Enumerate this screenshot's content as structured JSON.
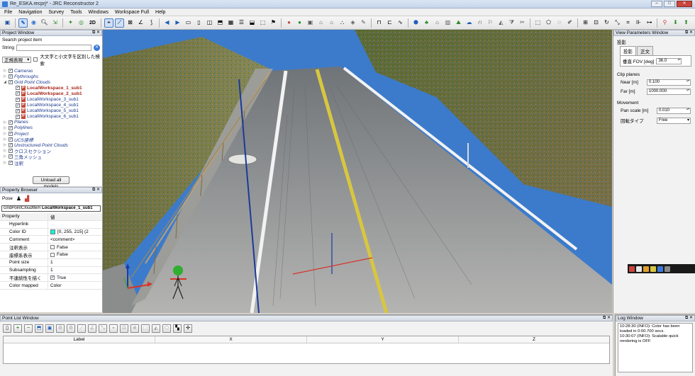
{
  "window": {
    "title": "Re_ESKA.recprj* - JRC Reconstructor 2"
  },
  "menu": [
    "File",
    "Navigation",
    "Survey",
    "Tools",
    "Windows",
    "Workspace Full",
    "Help"
  ],
  "toolbar": {
    "mode_2d_label": "2D"
  },
  "project_window": {
    "title": "Project Window",
    "search_label": "Search project item",
    "string_label": "String",
    "regex_select": "正規表現",
    "case_option_label": "大文字と小文字を区別した検索",
    "tree": [
      {
        "label": "Cameras",
        "style": "italic blue",
        "checked": true,
        "level": 0
      },
      {
        "label": "Flythroughs",
        "style": "italic blue",
        "checked": true,
        "level": 0
      },
      {
        "label": "Grid Point Clouds",
        "style": "italic blue",
        "checked": true,
        "level": 0
      },
      {
        "label": "LocalWorkspace_1_sub1",
        "style": "red",
        "checked": true,
        "level": 1
      },
      {
        "label": "LocalWorkspace_2_sub1",
        "style": "red",
        "checked": true,
        "level": 1
      },
      {
        "label": "LocalWorkspace_3_sub1",
        "style": "blue",
        "checked": true,
        "level": 1
      },
      {
        "label": "LocalWorkspace_4_sub1",
        "style": "blue",
        "checked": true,
        "level": 1
      },
      {
        "label": "LocalWorkspace_5_sub1",
        "style": "blue",
        "checked": true,
        "level": 1
      },
      {
        "label": "LocalWorkspace_6_sub1",
        "style": "blue",
        "checked": true,
        "level": 1
      },
      {
        "label": "Planes",
        "style": "italic blue",
        "checked": true,
        "level": 0
      },
      {
        "label": "Polylines",
        "style": "italic blue",
        "checked": true,
        "level": 0
      },
      {
        "label": "Project",
        "style": "italic blue",
        "checked": true,
        "level": 0
      },
      {
        "label": "UCS座標",
        "style": "italic blue",
        "checked": true,
        "level": 0
      },
      {
        "label": "Unstructured Point Clouds",
        "style": "italic blue",
        "checked": true,
        "level": 0
      },
      {
        "label": "クロスセクション",
        "style": "blue",
        "checked": true,
        "level": 0
      },
      {
        "label": "三角メッシュ",
        "style": "blue",
        "checked": true,
        "level": 0
      },
      {
        "label": "注釈",
        "style": "blue",
        "checked": true,
        "level": 0
      }
    ],
    "unload_button": "Unload all models"
  },
  "property_browser": {
    "title": "Property Browser",
    "pose_label": "Pose",
    "item_type": "GridPointCloudItem",
    "item_name": "LocalWorkspace_1_sub1",
    "header_key": "Property",
    "header_value": "値",
    "rows": [
      {
        "key": "Hyperlink",
        "value": ""
      },
      {
        "key": "Color ID",
        "value": "[0, 255, 215] (2"
      },
      {
        "key": "Comment",
        "value": "<comment>"
      },
      {
        "key": "注釈表示",
        "value": "False"
      },
      {
        "key": "座標系表示",
        "value": "False"
      },
      {
        "key": "Point size",
        "value": "1"
      },
      {
        "key": "Subsampling",
        "value": "1"
      },
      {
        "key": "不連続性を描く",
        "value": "True"
      },
      {
        "key": "Color mapped",
        "value": "Color"
      }
    ]
  },
  "view_params": {
    "title": "View Parameters Window",
    "projection_section": "投影",
    "tabs": [
      "投影",
      "正文"
    ],
    "fov_label": "垂直 FOV [deg]",
    "fov_value": "36.0",
    "clip_section": "Clip planes",
    "near_label": "Near [m]",
    "near_value": "0.100",
    "far_label": "Far [m]",
    "far_value": "1000.000",
    "movement_section": "Movement",
    "pan_label": "Pan scale [m]",
    "pan_value": "0.010",
    "rot_label": "回転タイプ",
    "rot_value": "Free"
  },
  "point_list": {
    "title": "Point List Window",
    "columns": [
      "Label",
      "X",
      "Y",
      "Z"
    ]
  },
  "log": {
    "title": "Log Window",
    "lines": [
      "10:28:30 (INFO): Color has been loaded in 0:00.700 secs.",
      "10:30:07 (INFO): Scalable quick rendering is OFF"
    ]
  },
  "colors": {
    "accent": "#3b79d8",
    "point_cloud_sky": "#3b79c9",
    "road": "#8e8e8e",
    "vegetation": "#5a6b3a",
    "swatch": "#00ffd7"
  }
}
